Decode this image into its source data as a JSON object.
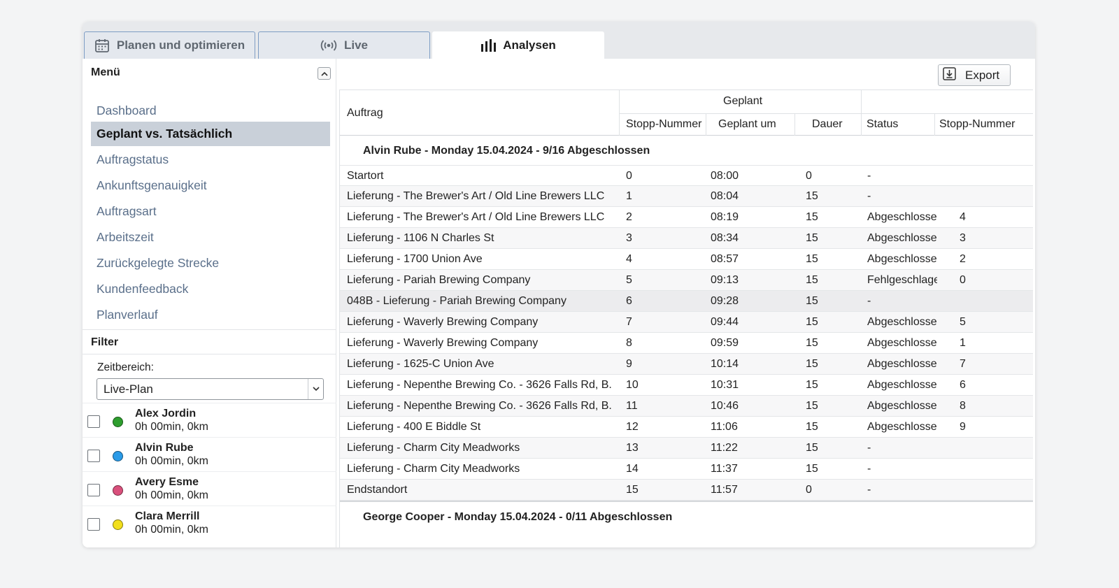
{
  "tabs": [
    {
      "label": "Planen und optimieren",
      "icon": "calendar-icon"
    },
    {
      "label": "Live",
      "icon": "broadcast-icon"
    },
    {
      "label": "Analysen",
      "icon": "bar-chart-icon"
    }
  ],
  "sidebar": {
    "menu_title": "Menü",
    "items": [
      {
        "label": "Dashboard"
      },
      {
        "label": "Geplant vs. Tatsächlich",
        "active": true
      },
      {
        "label": "Auftragstatus"
      },
      {
        "label": "Ankunftsgenauigkeit"
      },
      {
        "label": "Auftragsart"
      },
      {
        "label": "Arbeitszeit"
      },
      {
        "label": "Zurückgelegte Strecke"
      },
      {
        "label": "Kundenfeedback"
      },
      {
        "label": "Planverlauf"
      }
    ],
    "filter_title": "Filter",
    "time_range_label": "Zeitbereich:",
    "time_range_value": "Live-Plan",
    "drivers": [
      {
        "name": "Alex Jordin",
        "meta": "0h 00min, 0km",
        "color": "#2e9e2e"
      },
      {
        "name": "Alvin Rube",
        "meta": "0h 00min, 0km",
        "color": "#2a9be8"
      },
      {
        "name": "Avery Esme",
        "meta": "0h 00min, 0km",
        "color": "#d9507c"
      },
      {
        "name": "Clara Merrill",
        "meta": "0h 00min, 0km",
        "color": "#f2df1c"
      }
    ]
  },
  "main": {
    "export_label": "Export",
    "headers": {
      "auftrag": "Auftrag",
      "geplant_group": "Geplant",
      "stopp_nummer": "Stopp-Nummer",
      "geplant_um": "Geplant um",
      "dauer": "Dauer",
      "status": "Status",
      "stopp_nummer_2": "Stopp-Nummer"
    },
    "groups": [
      {
        "title": "Alvin Rube - Monday 15.04.2024 - 9/16 Abgeschlossen",
        "rows": [
          {
            "auftrag": "Startort",
            "stopp": "0",
            "zeit": "08:00",
            "dauer": "0",
            "status": "-",
            "stopp2": ""
          },
          {
            "auftrag": "Lieferung - The Brewer's Art / Old Line Brewers LLC",
            "stopp": "1",
            "zeit": "08:04",
            "dauer": "15",
            "status": "-",
            "stopp2": ""
          },
          {
            "auftrag": "Lieferung - The Brewer's Art / Old Line Brewers LLC",
            "stopp": "2",
            "zeit": "08:19",
            "dauer": "15",
            "status": "Abgeschlossen",
            "stopp2": "4"
          },
          {
            "auftrag": "Lieferung - 1106 N Charles St",
            "stopp": "3",
            "zeit": "08:34",
            "dauer": "15",
            "status": "Abgeschlossen",
            "stopp2": "3"
          },
          {
            "auftrag": "Lieferung - 1700 Union Ave",
            "stopp": "4",
            "zeit": "08:57",
            "dauer": "15",
            "status": "Abgeschlossen",
            "stopp2": "2"
          },
          {
            "auftrag": "Lieferung - Pariah Brewing Company",
            "stopp": "5",
            "zeit": "09:13",
            "dauer": "15",
            "status": "Fehlgeschlagen",
            "stopp2": "0"
          },
          {
            "auftrag": "048B - Lieferung - Pariah Brewing Company",
            "stopp": "6",
            "zeit": "09:28",
            "dauer": "15",
            "status": "-",
            "stopp2": "",
            "highlight": true
          },
          {
            "auftrag": "Lieferung - Waverly Brewing Company",
            "stopp": "7",
            "zeit": "09:44",
            "dauer": "15",
            "status": "Abgeschlossen",
            "stopp2": "5"
          },
          {
            "auftrag": "Lieferung - Waverly Brewing Company",
            "stopp": "8",
            "zeit": "09:59",
            "dauer": "15",
            "status": "Abgeschlossen",
            "stopp2": "1"
          },
          {
            "auftrag": "Lieferung - 1625-C Union Ave",
            "stopp": "9",
            "zeit": "10:14",
            "dauer": "15",
            "status": "Abgeschlossen",
            "stopp2": "7"
          },
          {
            "auftrag": "Lieferung - Nepenthe Brewing Co. - 3626 Falls Rd, B...",
            "stopp": "10",
            "zeit": "10:31",
            "dauer": "15",
            "status": "Abgeschlossen",
            "stopp2": "6"
          },
          {
            "auftrag": "Lieferung - Nepenthe Brewing Co. - 3626 Falls Rd, B...",
            "stopp": "11",
            "zeit": "10:46",
            "dauer": "15",
            "status": "Abgeschlossen",
            "stopp2": "8"
          },
          {
            "auftrag": "Lieferung - 400 E Biddle St",
            "stopp": "12",
            "zeit": "11:06",
            "dauer": "15",
            "status": "Abgeschlossen",
            "stopp2": "9"
          },
          {
            "auftrag": "Lieferung - Charm City Meadworks",
            "stopp": "13",
            "zeit": "11:22",
            "dauer": "15",
            "status": "-",
            "stopp2": ""
          },
          {
            "auftrag": "Lieferung - Charm City Meadworks",
            "stopp": "14",
            "zeit": "11:37",
            "dauer": "15",
            "status": "-",
            "stopp2": ""
          },
          {
            "auftrag": "Endstandort",
            "stopp": "15",
            "zeit": "11:57",
            "dauer": "0",
            "status": "-",
            "stopp2": ""
          }
        ]
      },
      {
        "title": "George Cooper - Monday 15.04.2024 - 0/11 Abgeschlossen",
        "rows": []
      }
    ]
  }
}
